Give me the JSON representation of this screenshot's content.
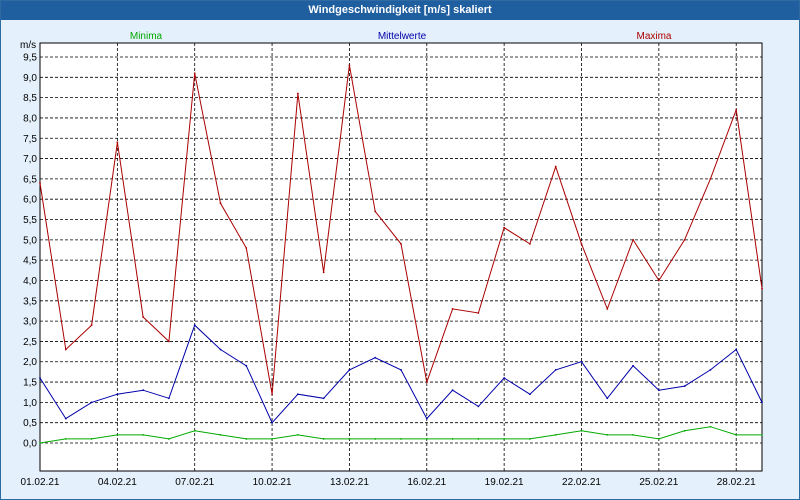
{
  "window": {
    "title": "Windgeschwindigkeit [m/s] skaliert"
  },
  "colors": {
    "minima": "#00aa00",
    "mittelwerte": "#0000aa",
    "maxima": "#aa0000",
    "grid": "#000000",
    "title_bar": "#1f5fa0",
    "frame": "#e4f0fb"
  },
  "chart_data": {
    "type": "line",
    "title": "Windgeschwindigkeit [m/s] skaliert",
    "ylabel": "m/s",
    "xlabel": "",
    "ylim": [
      0,
      9.5
    ],
    "yticks": [
      "0,0",
      "0,5",
      "1,0",
      "1,5",
      "2,0",
      "2,5",
      "3,0",
      "3,5",
      "4,0",
      "4,5",
      "5,0",
      "5,5",
      "6,0",
      "6,5",
      "7,0",
      "7,5",
      "8,0",
      "8,5",
      "9,0",
      "9,5"
    ],
    "xlim": [
      "01.02.21",
      "01.03.21"
    ],
    "xticks": [
      "01.02.21",
      "04.02.21",
      "07.02.21",
      "10.02.21",
      "13.02.21",
      "16.02.21",
      "19.02.21",
      "22.02.21",
      "25.02.21",
      "28.02.21"
    ],
    "grid": true,
    "x": [
      "01.02.21",
      "02.02.21",
      "03.02.21",
      "04.02.21",
      "05.02.21",
      "06.02.21",
      "07.02.21",
      "08.02.21",
      "09.02.21",
      "10.02.21",
      "11.02.21",
      "12.02.21",
      "13.02.21",
      "14.02.21",
      "15.02.21",
      "16.02.21",
      "17.02.21",
      "18.02.21",
      "19.02.21",
      "20.02.21",
      "21.02.21",
      "22.02.21",
      "23.02.21",
      "24.02.21",
      "25.02.21",
      "26.02.21",
      "27.02.21",
      "28.02.21",
      "01.03.21"
    ],
    "series": [
      {
        "name": "Minima",
        "values": [
          0.0,
          0.1,
          0.1,
          0.2,
          0.2,
          0.1,
          0.3,
          0.2,
          0.1,
          0.1,
          0.2,
          0.1,
          0.1,
          0.1,
          0.1,
          0.1,
          0.1,
          0.1,
          0.1,
          0.1,
          0.2,
          0.3,
          0.2,
          0.2,
          0.1,
          0.3,
          0.4,
          0.2,
          0.2
        ]
      },
      {
        "name": "Mittelwerte",
        "values": [
          1.6,
          0.6,
          1.0,
          1.2,
          1.3,
          1.1,
          2.9,
          2.3,
          1.9,
          0.5,
          1.2,
          1.1,
          1.8,
          2.1,
          1.8,
          0.6,
          1.3,
          0.9,
          1.6,
          1.2,
          1.8,
          2.0,
          1.1,
          1.9,
          1.3,
          1.4,
          1.8,
          2.3,
          1.0
        ]
      },
      {
        "name": "Maxima",
        "values": [
          6.4,
          2.3,
          2.9,
          7.4,
          3.1,
          2.5,
          9.1,
          5.9,
          4.8,
          1.2,
          8.6,
          4.2,
          9.3,
          5.7,
          4.9,
          1.5,
          3.3,
          3.2,
          5.3,
          4.9,
          6.8,
          4.9,
          3.3,
          5.0,
          4.0,
          5.0,
          6.5,
          8.2,
          3.8
        ]
      }
    ]
  }
}
